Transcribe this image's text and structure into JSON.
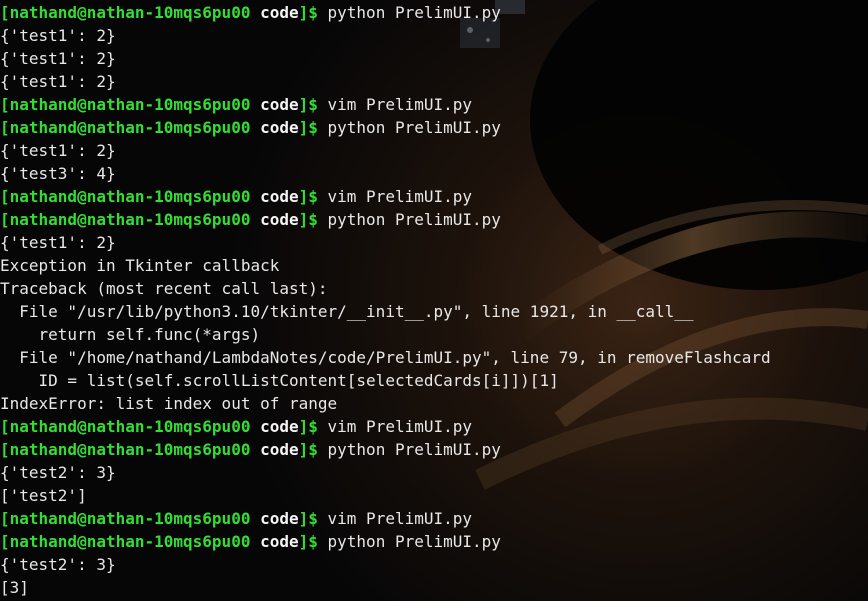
{
  "terminal": {
    "lines": [
      {
        "type": "prompt",
        "user_host": "[nathand@nathan-10mqs6pu00",
        "cwd": "code",
        "close": "]$",
        "command": " python PrelimUI.py"
      },
      {
        "type": "output",
        "text": "{'test1': 2}"
      },
      {
        "type": "output",
        "text": "{'test1': 2}"
      },
      {
        "type": "output",
        "text": "{'test1': 2}"
      },
      {
        "type": "prompt",
        "user_host": "[nathand@nathan-10mqs6pu00",
        "cwd": "code",
        "close": "]$",
        "command": " vim PrelimUI.py"
      },
      {
        "type": "prompt",
        "user_host": "[nathand@nathan-10mqs6pu00",
        "cwd": "code",
        "close": "]$",
        "command": " python PrelimUI.py"
      },
      {
        "type": "output",
        "text": "{'test1': 2}"
      },
      {
        "type": "output",
        "text": "{'test3': 4}"
      },
      {
        "type": "prompt",
        "user_host": "[nathand@nathan-10mqs6pu00",
        "cwd": "code",
        "close": "]$",
        "command": " vim PrelimUI.py"
      },
      {
        "type": "prompt",
        "user_host": "[nathand@nathan-10mqs6pu00",
        "cwd": "code",
        "close": "]$",
        "command": " python PrelimUI.py"
      },
      {
        "type": "output",
        "text": "{'test1': 2}"
      },
      {
        "type": "output",
        "text": "Exception in Tkinter callback"
      },
      {
        "type": "output",
        "text": "Traceback (most recent call last):"
      },
      {
        "type": "output",
        "text": "  File \"/usr/lib/python3.10/tkinter/__init__.py\", line 1921, in __call__"
      },
      {
        "type": "output",
        "text": "    return self.func(*args)"
      },
      {
        "type": "output",
        "text": "  File \"/home/nathand/LambdaNotes/code/PrelimUI.py\", line 79, in removeFlashcard"
      },
      {
        "type": "output",
        "text": "    ID = list(self.scrollListContent[selectedCards[i]])[1]"
      },
      {
        "type": "output",
        "text": "IndexError: list index out of range"
      },
      {
        "type": "prompt",
        "user_host": "[nathand@nathan-10mqs6pu00",
        "cwd": "code",
        "close": "]$",
        "command": " vim PrelimUI.py"
      },
      {
        "type": "prompt",
        "user_host": "[nathand@nathan-10mqs6pu00",
        "cwd": "code",
        "close": "]$",
        "command": " python PrelimUI.py"
      },
      {
        "type": "output",
        "text": "{'test2': 3}"
      },
      {
        "type": "output",
        "text": "['test2']"
      },
      {
        "type": "prompt",
        "user_host": "[nathand@nathan-10mqs6pu00",
        "cwd": "code",
        "close": "]$",
        "command": " vim PrelimUI.py"
      },
      {
        "type": "prompt",
        "user_host": "[nathand@nathan-10mqs6pu00",
        "cwd": "code",
        "close": "]$",
        "command": " python PrelimUI.py"
      },
      {
        "type": "output",
        "text": "{'test2': 3}"
      },
      {
        "type": "output",
        "text": "[3]"
      }
    ]
  },
  "colors": {
    "prompt_user_host": "#33dd33",
    "prompt_cwd": "#f4f4f4",
    "output_text": "#e8e8e8",
    "background": "#050506"
  }
}
